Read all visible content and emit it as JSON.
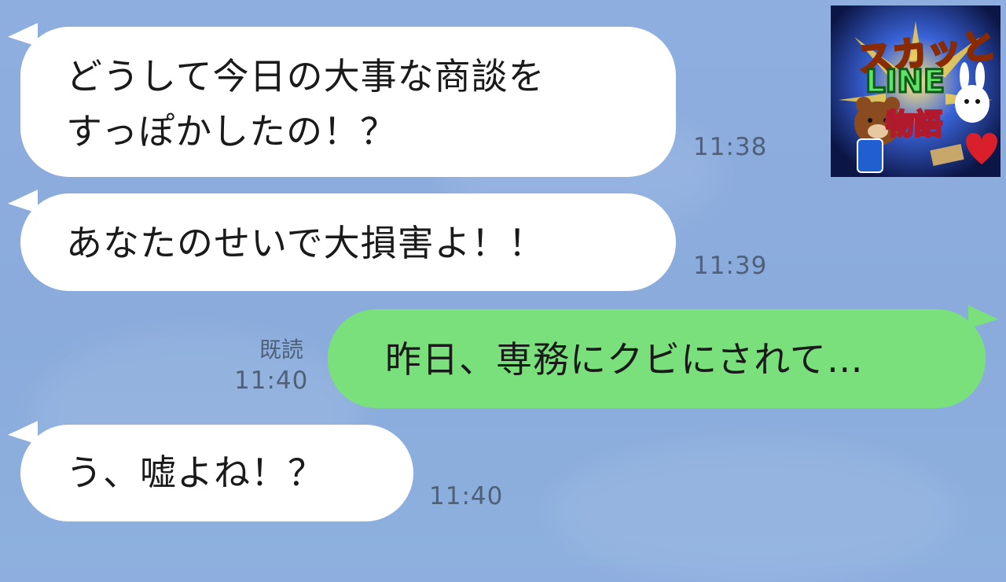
{
  "messages": [
    {
      "side": "in",
      "text_lines": [
        "どうして今日の大事な商談を",
        "すっぽかしたの！？"
      ],
      "time": "11:38"
    },
    {
      "side": "in",
      "text_lines": [
        "あなたのせいで大損害よ！！"
      ],
      "time": "11:39"
    },
    {
      "side": "out",
      "text_lines": [
        "昨日、専務にクビにされて…"
      ],
      "time": "11:40",
      "read_label": "既読"
    },
    {
      "side": "in",
      "text_lines": [
        "う、嘘よね！？"
      ],
      "time": "11:40"
    }
  ],
  "logo": {
    "line1": "スカッと",
    "line2": "LINE",
    "line3": "物語"
  },
  "colors": {
    "background": "#8eaee0",
    "incoming": "#ffffff",
    "outgoing": "#79e07c",
    "time": "#4f6079"
  }
}
